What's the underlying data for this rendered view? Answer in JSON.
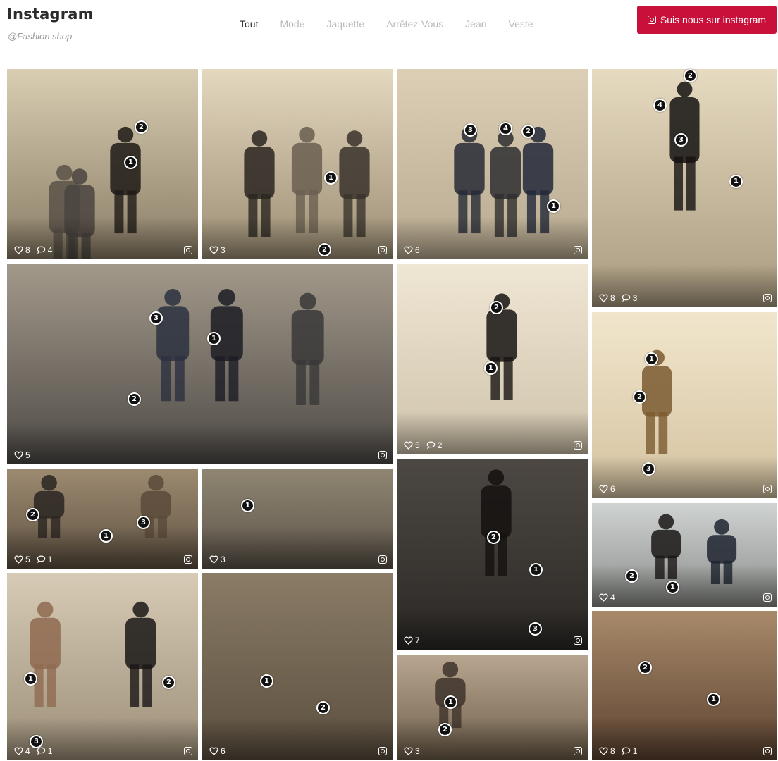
{
  "header": {
    "title": "Instagram",
    "subtitle": "@Fashion shop",
    "follow_label": "Suis nous sur instagram"
  },
  "filters": [
    "Tout",
    "Mode",
    "Jaquette",
    "Arrêtez-Vous",
    "Jean",
    "Veste"
  ],
  "active_filter": "Tout",
  "colors": {
    "accent": "#c8103b",
    "hotspot": "#111111",
    "active_filter": "#2f2f2f",
    "inactive_filter": "#b9b9b9"
  },
  "posts": [
    {
      "name": "post-woman-phone",
      "likes": "8",
      "comments": "4",
      "hotspots": [
        "2",
        "1"
      ]
    },
    {
      "name": "post-group-bicycle",
      "likes": "3",
      "comments": "",
      "hotspots": [
        "1",
        "2"
      ]
    },
    {
      "name": "post-three-men-suits",
      "likes": "6",
      "comments": "",
      "hotspots": [
        "3",
        "4",
        "2",
        "1"
      ]
    },
    {
      "name": "post-man-black-suit",
      "likes": "8",
      "comments": "3",
      "hotspots": [
        "2",
        "4",
        "3",
        "1"
      ]
    },
    {
      "name": "post-business-walk",
      "likes": "5",
      "comments": "",
      "hotspots": [
        "3",
        "1",
        "2"
      ]
    },
    {
      "name": "post-man-photo-wall",
      "likes": "5",
      "comments": "2",
      "hotspots": [
        "2",
        "1"
      ]
    },
    {
      "name": "post-man-columns",
      "likes": "6",
      "comments": "",
      "hotspots": [
        "1",
        "2",
        "3"
      ]
    },
    {
      "name": "post-friends-bench",
      "likes": "5",
      "comments": "1",
      "hotspots": [
        "2",
        "3",
        "1"
      ]
    },
    {
      "name": "post-flatlay-glasses",
      "likes": "3",
      "comments": "",
      "hotspots": [
        "1"
      ]
    },
    {
      "name": "post-woman-leather-jacket",
      "likes": "7",
      "comments": "",
      "hotspots": [
        "2",
        "1",
        "3"
      ]
    },
    {
      "name": "post-street-crossing",
      "likes": "4",
      "comments": "",
      "hotspots": [
        "2",
        "1"
      ]
    },
    {
      "name": "post-two-women-columns",
      "likes": "4",
      "comments": "1",
      "hotspots": [
        "1",
        "2",
        "3"
      ]
    },
    {
      "name": "post-shoes-tie-camera",
      "likes": "6",
      "comments": "",
      "hotspots": [
        "1",
        "2"
      ]
    },
    {
      "name": "post-woman-street",
      "likes": "3",
      "comments": "",
      "hotspots": [
        "1",
        "2"
      ]
    },
    {
      "name": "post-leather-bag",
      "likes": "8",
      "comments": "1",
      "hotspots": [
        "2",
        "1"
      ]
    }
  ]
}
